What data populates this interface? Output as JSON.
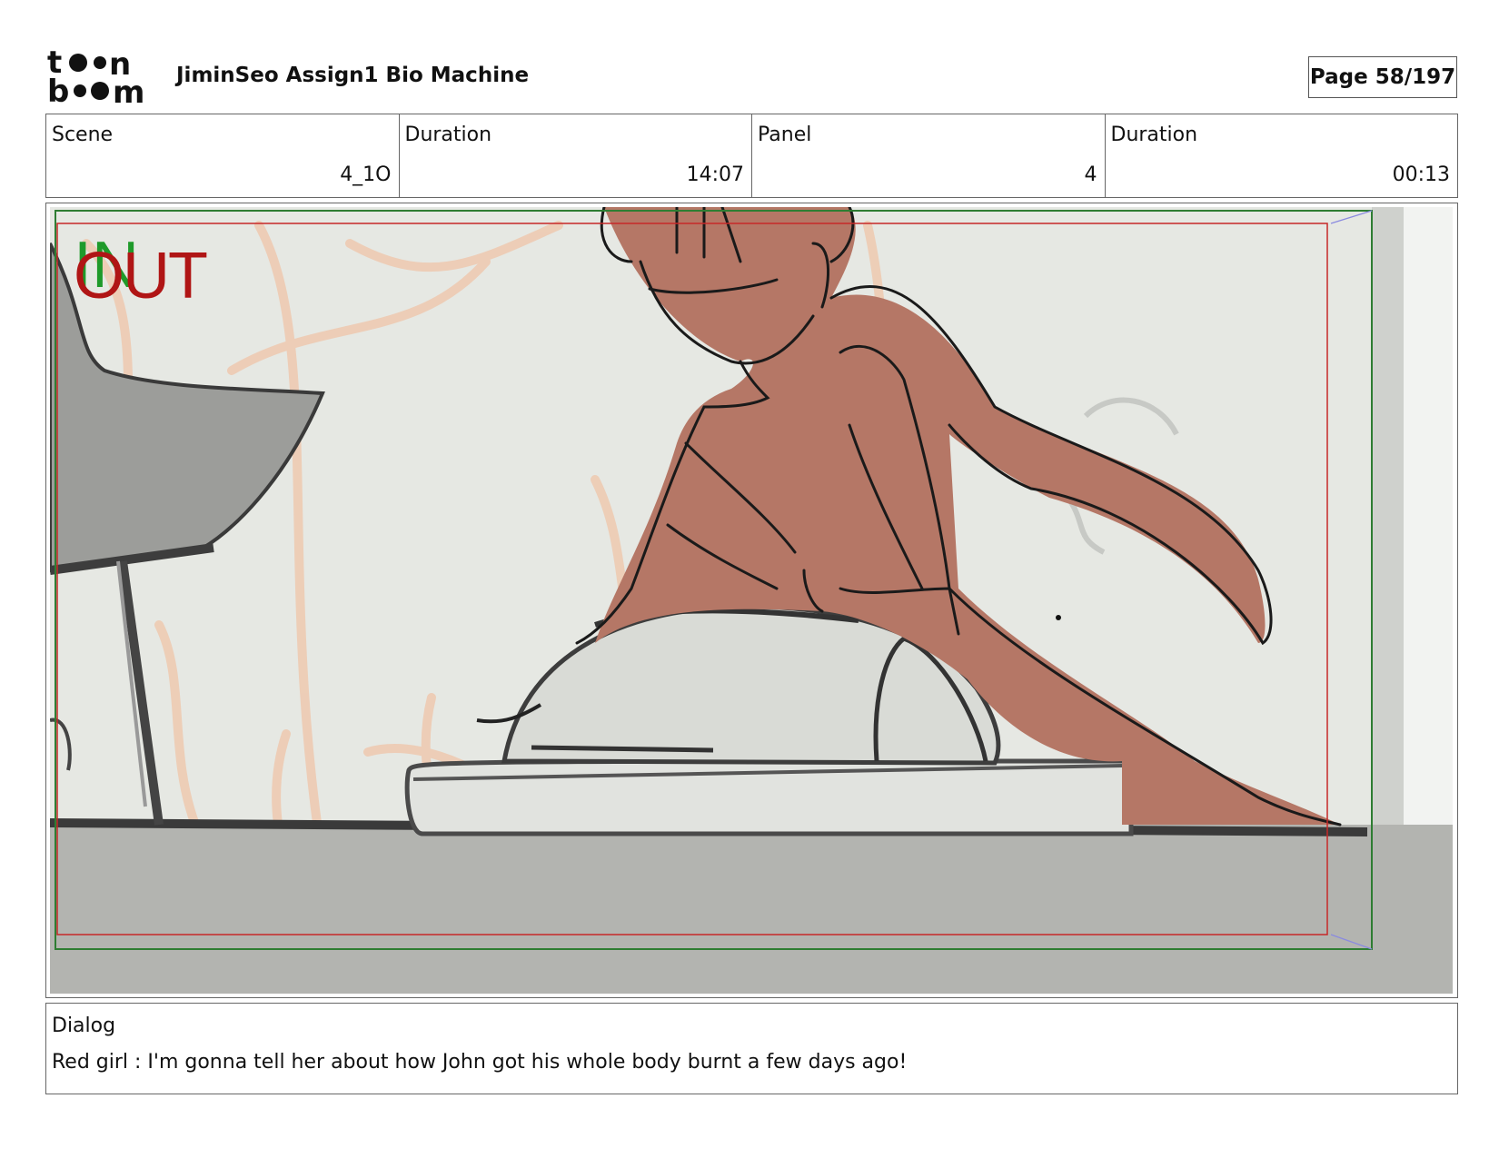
{
  "header": {
    "logo_text": "toon boom",
    "project_title": "JiminSeo Assign1 Bio Machine",
    "page_label": "Page",
    "page_value": "58/197"
  },
  "info": {
    "scene_label": "Scene",
    "scene_value": "4_1O",
    "scene_duration_label": "Duration",
    "scene_duration_value": "14:07",
    "panel_label": "Panel",
    "panel_value": "4",
    "panel_duration_label": "Duration",
    "panel_duration_value": "00:13"
  },
  "frame": {
    "in_label": "IN",
    "out_label": "OUT"
  },
  "dialog": {
    "label": "Dialog",
    "text": "Red girl : I'm gonna tell her about how John got his whole body burnt a few days ago!"
  },
  "colors": {
    "in_green": "#1f9a2a",
    "out_red": "#b01515",
    "skin": "#b57766",
    "background_wall": "#e6e8e3",
    "table_gray": "#b3b4b0"
  }
}
